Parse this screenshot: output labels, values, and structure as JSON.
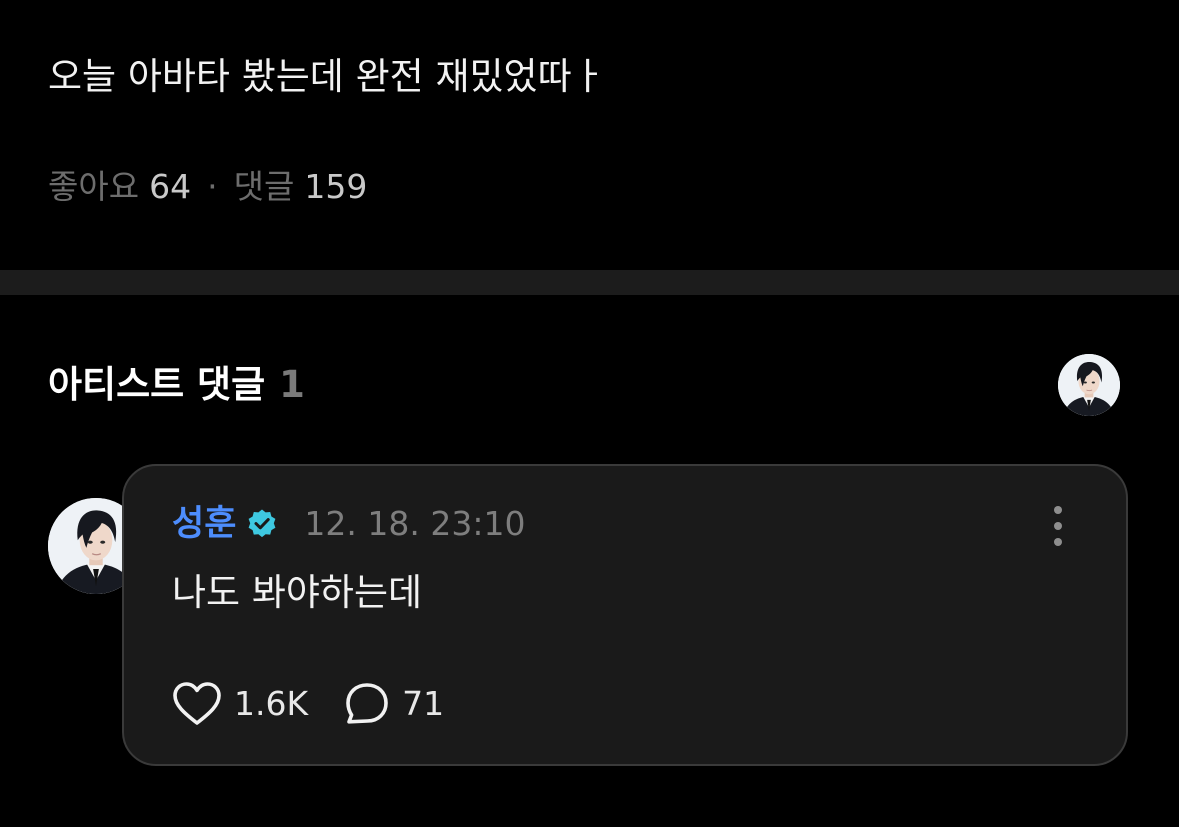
{
  "post": {
    "text": "오늘 아바타 봤는데 완전 재밌었따ㅏ"
  },
  "stats": {
    "likes_label": "좋아요",
    "likes_count": "64",
    "separator": "·",
    "comments_label": "댓글",
    "comments_count": "159"
  },
  "artist_section": {
    "title": "아티스트 댓글",
    "count": "1"
  },
  "comment": {
    "author": "성훈",
    "timestamp": "12. 18. 23:10",
    "text": "나도 봐야하는데",
    "likes": "1.6K",
    "replies": "71"
  },
  "colors": {
    "background": "#000000",
    "card_background": "#1a1a1a",
    "card_border": "#3a3a3a",
    "divider": "#1c1c1c",
    "author_blue": "#4d8dfd",
    "verified_teal": "#3ec8e0",
    "muted_text": "#6d6d6d"
  },
  "icons": {
    "verified": "verified-badge-icon",
    "more": "more-vertical-icon",
    "like": "heart-outline-icon",
    "reply": "speech-bubble-icon"
  }
}
